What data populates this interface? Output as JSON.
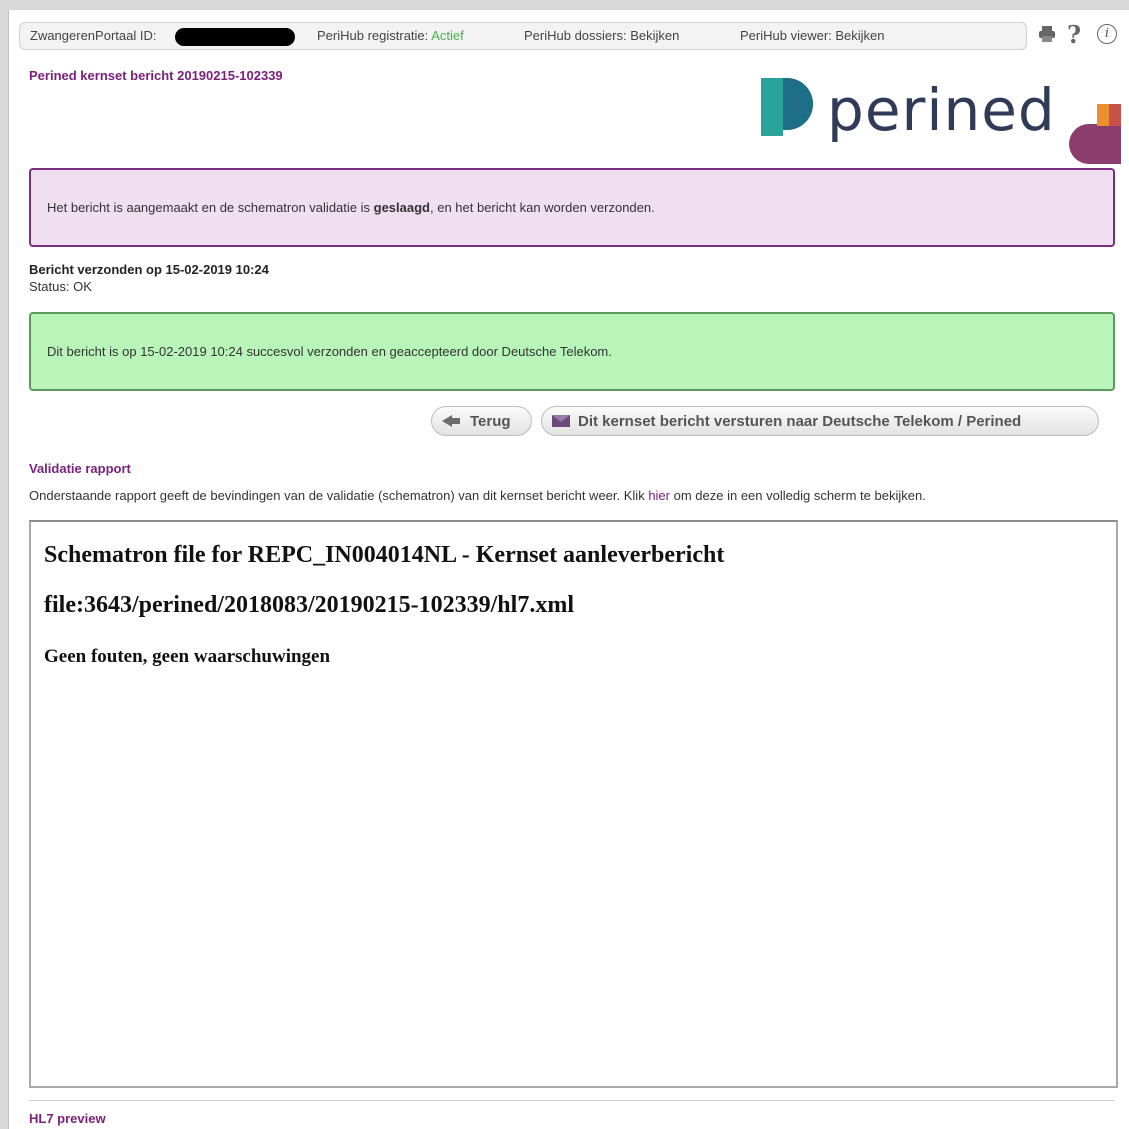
{
  "topbar": {
    "portal_id_label": "ZwangerenPortaal ID:",
    "registration_label": "PeriHub registratie:",
    "registration_status": "Actief",
    "dossiers": "PeriHub dossiers: Bekijken",
    "viewer": "PeriHub viewer: Bekijken",
    "icons": [
      "printer-icon",
      "help-icon",
      "info-icon"
    ]
  },
  "page_title": "Perined kernset bericht 20190215-102339",
  "logo": {
    "wordmark": "perined"
  },
  "validation_alert": {
    "prefix": "Het bericht is aangemaakt en de schematron validatie is ",
    "emphasis": "geslaagd",
    "suffix": ", en het bericht kan worden verzonden."
  },
  "sent": {
    "heading": "Bericht verzonden op 15-02-2019 10:24",
    "status": "Status: OK"
  },
  "success_alert": "Dit bericht is op 15-02-2019 10:24 succesvol verzonden en geaccepteerd door Deutsche Telekom.",
  "buttons": {
    "back": "Terug",
    "send": "Dit kernset bericht versturen naar Deutsche Telekom / Perined"
  },
  "validation_report": {
    "title": "Validatie rapport",
    "desc_prefix": "Onderstaande rapport geeft de bevindingen van de validatie (schematron) van dit kernset bericht weer. Klik ",
    "link": "hier",
    "desc_suffix": " om deze in een volledig scherm te bekijken.",
    "frame": {
      "heading": "Schematron file for REPC_IN004014NL - Kernset aanleverbericht",
      "file": "file:3643/perined/2018083/20190215-102339/hl7.xml",
      "result": "Geen fouten, geen waarschuwingen"
    }
  },
  "hl7_preview": "HL7 preview",
  "colors": {
    "brand_purple": "#7a1f7a",
    "alert_purple_bg": "#f0dff0",
    "alert_green_bg": "#b9f5b9",
    "active_green": "#4caf50"
  }
}
